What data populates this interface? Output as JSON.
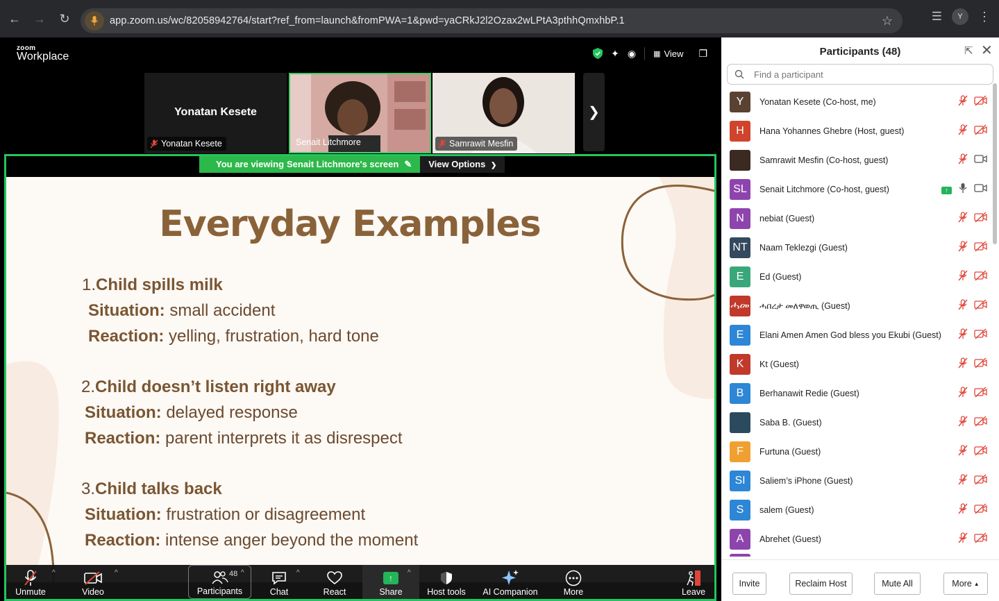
{
  "browser": {
    "url": "app.zoom.us/wc/82058942764/start?ref_from=launch&fromPWA=1&pwd=yaCRkJ2l2Ozax2wLPtA3pthhQmxhbP.1",
    "profile_initial": "Y"
  },
  "header": {
    "logo_small": "zoom",
    "logo_big": "Workplace",
    "view_label": "View"
  },
  "video_strip": [
    {
      "name": "Yonatan Kesete",
      "big_name": "Yonatan Kesete",
      "muted": true
    },
    {
      "name": "Senait Litchmore",
      "muted": false
    },
    {
      "name": "Samrawit Mesfin",
      "muted": true
    }
  ],
  "share": {
    "viewing_prefix": "You are viewing",
    "viewing_name": "Senait Litchmore's screen",
    "view_options": "View Options"
  },
  "slide": {
    "title": "Everyday Examples",
    "items": [
      {
        "num": "1.",
        "heading": "Child spills milk",
        "situation_label": "Situation:",
        "situation": "small accident",
        "reaction_label": "Reaction:",
        "reaction": "yelling, frustration, hard tone"
      },
      {
        "num": "2.",
        "heading": "Child doesn’t listen right away",
        "situation_label": "Situation:",
        "situation": "delayed response",
        "reaction_label": "Reaction:",
        "reaction": "parent interprets it as disrespect"
      },
      {
        "num": "3.",
        "heading": "Child talks back",
        "situation_label": "Situation:",
        "situation": "frustration or disagreement",
        "reaction_label": "Reaction:",
        "reaction": "intense anger beyond the moment"
      }
    ]
  },
  "toolbar": {
    "unmute": "Unmute",
    "video": "Video",
    "participants": "Participants",
    "participants_count": "48",
    "chat": "Chat",
    "react": "React",
    "share": "Share",
    "host_tools": "Host tools",
    "ai_companion": "AI Companion",
    "more": "More",
    "leave": "Leave"
  },
  "panel": {
    "title": "Participants (48)",
    "search_placeholder": "Find a participant",
    "participants": [
      {
        "initials": "Y",
        "color": "#5a4233",
        "name": "Yonatan Kesete (Co-host, me)",
        "mic": "muted",
        "video": "off"
      },
      {
        "initials": "H",
        "color": "#d0432c",
        "name": "Hana Yohannes Ghebre (Host, guest)",
        "mic": "muted",
        "video": "off"
      },
      {
        "initials": "",
        "color": "#3a2a22",
        "name": "Samrawit Mesfin (Co-host, guest)",
        "mic": "muted",
        "video": "on"
      },
      {
        "initials": "SL",
        "color": "#8e44ad",
        "name": "Senait Litchmore (Co-host, guest)",
        "mic": "on",
        "video": "on",
        "sharing": true
      },
      {
        "initials": "N",
        "color": "#8e44ad",
        "name": "nebiat (Guest)",
        "mic": "muted",
        "video": "off"
      },
      {
        "initials": "NT",
        "color": "#34495e",
        "name": "Naam Teklezgi (Guest)",
        "mic": "muted",
        "video": "off"
      },
      {
        "initials": "E",
        "color": "#3aa77a",
        "name": "Ed (Guest)",
        "mic": "muted",
        "video": "off"
      },
      {
        "initials": "ሓመ",
        "color": "#c0392b",
        "name": "ሓበረታ መለዋወጢ (Guest)",
        "mic": "muted",
        "video": "off"
      },
      {
        "initials": "E",
        "color": "#2d86d6",
        "name": "Elani Amen Amen God bless you Ekubi (Guest)",
        "mic": "muted",
        "video": "off"
      },
      {
        "initials": "K",
        "color": "#c0392b",
        "name": "Kt (Guest)",
        "mic": "muted",
        "video": "off"
      },
      {
        "initials": "B",
        "color": "#2d86d6",
        "name": "Berhanawit Redie (Guest)",
        "mic": "muted",
        "video": "off"
      },
      {
        "initials": "",
        "color": "#2c4a5e",
        "name": "Saba B. (Guest)",
        "mic": "muted",
        "video": "off"
      },
      {
        "initials": "F",
        "color": "#f0a030",
        "name": "Furtuna (Guest)",
        "mic": "muted",
        "video": "off"
      },
      {
        "initials": "SI",
        "color": "#2d86d6",
        "name": "Saliem’s iPhone (Guest)",
        "mic": "muted",
        "video": "off"
      },
      {
        "initials": "S",
        "color": "#2d86d6",
        "name": "salem (Guest)",
        "mic": "muted",
        "video": "off"
      },
      {
        "initials": "A",
        "color": "#8e44ad",
        "name": "Abrehet (Guest)",
        "mic": "muted",
        "video": "off"
      }
    ],
    "buttons": {
      "invite": "Invite",
      "reclaim_host": "Reclaim Host",
      "mute_all": "Mute All",
      "more": "More"
    }
  }
}
